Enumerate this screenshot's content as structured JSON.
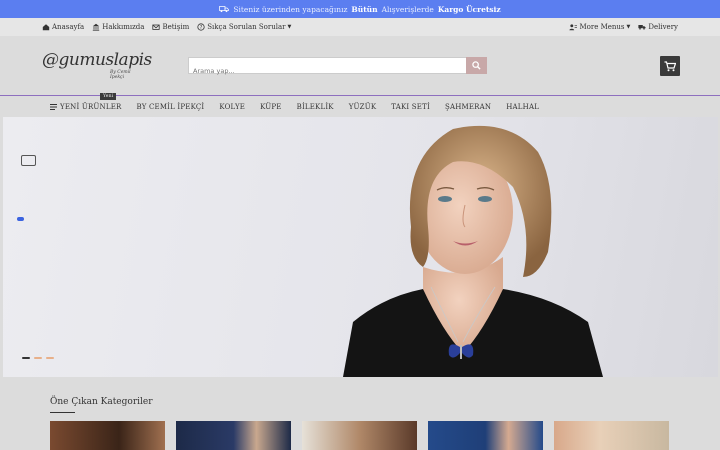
{
  "promo": {
    "prefix": "Siteniz üzerinden yapacağınız",
    "highlight1": "Bütün",
    "middle": "Alışverişlerde",
    "highlight2": "Kargo Ücretsiz"
  },
  "topnav": {
    "left": [
      {
        "label": "Anasayfa",
        "icon": "home-icon"
      },
      {
        "label": "Hakkımızda",
        "icon": "bank-icon"
      },
      {
        "label": "Betişim",
        "icon": "mail-icon"
      },
      {
        "label": "Sıkça Sorulan Sorular",
        "icon": "question-icon"
      }
    ],
    "more_label": "More Menus",
    "delivery_label": "Delivery"
  },
  "header": {
    "logo_text": "@gumuslapis",
    "logo_sub": "By Cemil İpekçi",
    "search_placeholder": "Arama yap...",
    "search_icon": "search-icon",
    "cart_icon": "cart-icon"
  },
  "categories": {
    "badge": "Yeni",
    "items": [
      "YENİ ÜRÜNLER",
      "BY CEMİL İPEKÇİ",
      "KOLYE",
      "KÜPE",
      "BİLEKLİK",
      "YÜZÜK",
      "TAKI SETİ",
      "ŞAHMERAN",
      "HALHAL"
    ]
  },
  "slider": {
    "dot_colors": [
      "#333333",
      "#e8b08a",
      "#e8b08a"
    ],
    "active_index": 0
  },
  "featured": {
    "title": "Öne Çıkan Kategoriler"
  },
  "colors": {
    "promo_bg": "#5b7ef0",
    "accent_line": "#8e6fbf",
    "cart_bg": "#3a3a3a"
  }
}
